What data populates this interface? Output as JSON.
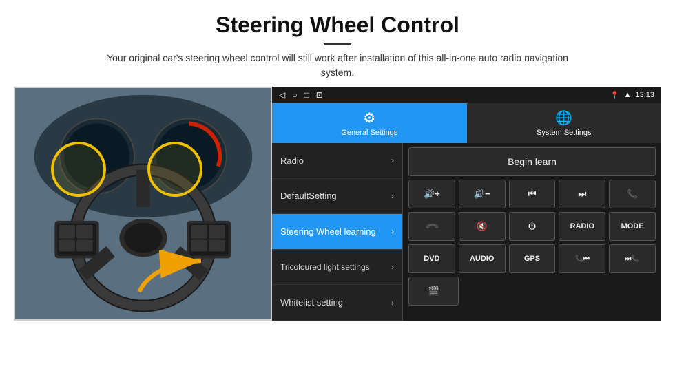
{
  "header": {
    "title": "Steering Wheel Control",
    "subtitle": "Your original car's steering wheel control will still work after installation of this all-in-one auto radio navigation system."
  },
  "status_bar": {
    "nav_icons": [
      "◁",
      "○",
      "□",
      "⊡"
    ],
    "time": "13:13",
    "signal_icon": "location",
    "wifi_icon": "wifi"
  },
  "tabs": [
    {
      "id": "general",
      "label": "General Settings",
      "icon": "⚙",
      "active": true
    },
    {
      "id": "system",
      "label": "System Settings",
      "icon": "🌐",
      "active": false
    }
  ],
  "menu_items": [
    {
      "id": "radio",
      "label": "Radio",
      "active": false
    },
    {
      "id": "default",
      "label": "DefaultSetting",
      "active": false
    },
    {
      "id": "steering",
      "label": "Steering Wheel learning",
      "active": true
    },
    {
      "id": "tricoloured",
      "label": "Tricoloured light settings",
      "active": false
    },
    {
      "id": "whitelist",
      "label": "Whitelist setting",
      "active": false
    }
  ],
  "controls": {
    "begin_learn_label": "Begin learn",
    "row1": [
      "🔊+",
      "🔊−",
      "⏮",
      "⏭",
      "📞"
    ],
    "row1_symbols": [
      "vol+",
      "vol-",
      "prev",
      "next",
      "phone"
    ],
    "row2_symbols": [
      "phone-down",
      "mute",
      "power",
      "RADIO",
      "MODE"
    ],
    "row2_labels": [
      "↩",
      "🔇x",
      "⏻",
      "RADIO",
      "MODE"
    ],
    "row3_labels": [
      "DVD",
      "AUDIO",
      "GPS",
      "📞⏮",
      "⏭📞"
    ],
    "row4": [
      "📋"
    ]
  }
}
